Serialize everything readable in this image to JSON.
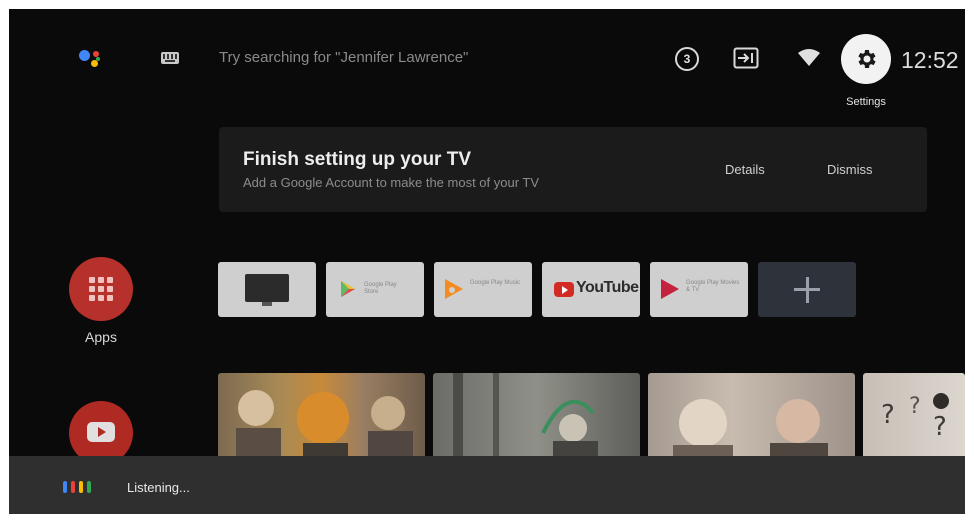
{
  "topbar": {
    "search_placeholder": "Try searching for \"Jennifer Lawrence\"",
    "notification_count": "3",
    "settings_label": "Settings",
    "clock": "12:52",
    "assistant_colors": [
      "#4285F4",
      "#EA4335",
      "#FBBC05",
      "#34A853"
    ]
  },
  "banner": {
    "title": "Finish setting up your TV",
    "subtitle": "Add a Google Account to make the most of your TV",
    "details_label": "Details",
    "dismiss_label": "Dismiss"
  },
  "rail": {
    "apps_label": "Apps"
  },
  "favorites": {
    "play_store_text": "Google Play Store",
    "play_music_text": "Google Play Music",
    "youtube_text": "YouTube",
    "play_movies_text": "Google Play Movies & TV"
  },
  "listening": {
    "label": "Listening...",
    "bar_colors": [
      "#4285F4",
      "#EA4335",
      "#FBBC05",
      "#34A853"
    ]
  },
  "colors": {
    "background": "#0a0a0a",
    "apps_red": "#b7312c",
    "youtube_red": "#d42a24",
    "listening_bar": "#2f2f2f"
  }
}
